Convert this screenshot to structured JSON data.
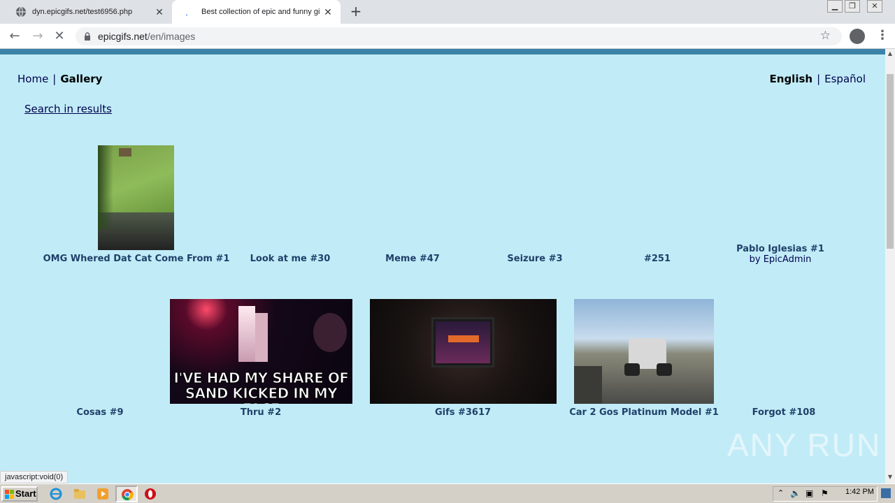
{
  "browser": {
    "tabs": [
      {
        "title": "dyn.epicgifs.net/test6956.php",
        "active": false
      },
      {
        "title": "Best collection of epic and funny gifs",
        "active": true
      }
    ],
    "new_tab_label": "+",
    "url_host": "epicgifs.net",
    "url_path": "/en/images",
    "status_text": "javascript:void(0)"
  },
  "nav": {
    "home": "Home",
    "separator": "|",
    "gallery": "Gallery"
  },
  "lang": {
    "english": "English",
    "separator": "|",
    "spanish": "Español"
  },
  "search_link": "Search in results",
  "gallery": {
    "row1": [
      {
        "title": "OMG Whered Dat Cat Come From #1",
        "has_thumb": true
      },
      {
        "title": "Look at me #30",
        "has_thumb": false
      },
      {
        "title": "Meme #47",
        "has_thumb": false
      },
      {
        "title": "Seizure #3",
        "has_thumb": false
      },
      {
        "title": "#251",
        "has_thumb": false
      },
      {
        "title": "Pablo Iglesias #1",
        "by": "by EpicAdmin",
        "has_thumb": false
      }
    ],
    "row2": [
      {
        "title": "Cosas #9",
        "has_thumb": false
      },
      {
        "title": "Thru #2",
        "has_thumb": true,
        "thumb_text_line1": "I'VE HAD MY SHARE OF",
        "thumb_text_line2": "SAND KICKED IN MY FACE"
      },
      {
        "title": "Gifs #3617",
        "has_thumb": true
      },
      {
        "title": "Car 2 Gos Platinum Model #1",
        "has_thumb": true
      },
      {
        "title": "Forgot #108",
        "has_thumb": false
      }
    ]
  },
  "watermark": "ANY RUN",
  "taskbar": {
    "start_label": "Start",
    "clock": "1:42 PM"
  },
  "colors": {
    "page_bg": "#c1ecf7",
    "link": "#00004d",
    "title_text": "#20406a"
  }
}
